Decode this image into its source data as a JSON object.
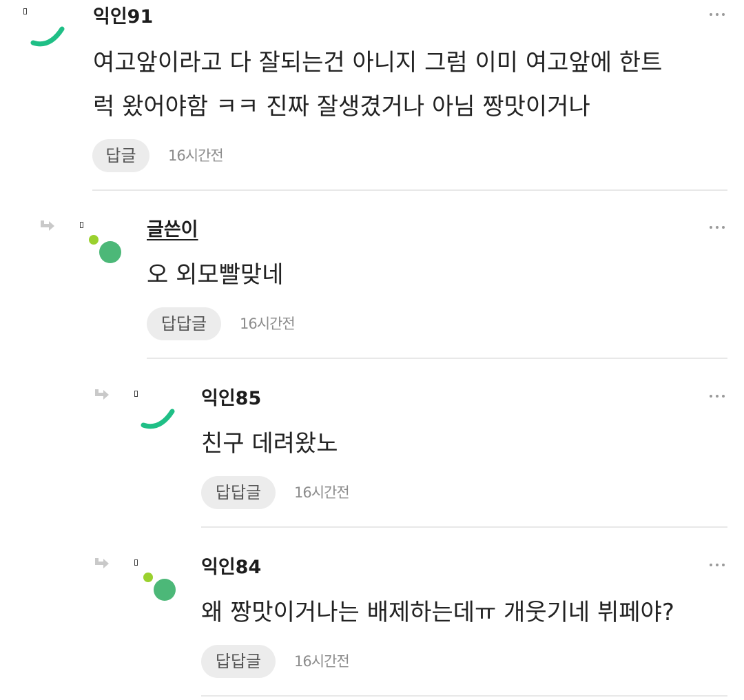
{
  "comments": [
    {
      "username": "익인91",
      "is_author": false,
      "content_line1": "여고앞이라고 다 잘되는건 아니지 그럼 이미 여고앞에 한트",
      "content_line2": "럭 왔어야함 ㅋㅋ 진짜 잘생겼거나 아님 짱맛이거나",
      "reply_label": "답글",
      "timestamp": "16시간전",
      "avatar_icon": "green-arc-avatar-icon"
    },
    {
      "username": "글쓴이",
      "is_author": true,
      "content_line1": "오 외모빨맞네",
      "reply_label": "답답글",
      "timestamp": "16시간전",
      "avatar_icon": "green-dot-avatar-icon"
    },
    {
      "username": "익인85",
      "is_author": false,
      "content_line1": "친구 데려왔노",
      "reply_label": "답답글",
      "timestamp": "16시간전",
      "avatar_icon": "green-arc-avatar-icon"
    },
    {
      "username": "익인84",
      "is_author": false,
      "content_line1": "왜 짱맛이거나는 배제하는데ㅠ 개웃기네 뷔페야?",
      "reply_label": "답답글",
      "timestamp": "16시간전",
      "avatar_icon": "green-dot-avatar-icon"
    }
  ],
  "colors": {
    "accent_green": "#1fbf86",
    "avatar_green": "#4cb878",
    "avatar_lime": "#9ad12e",
    "reply_button_bg": "#ececec",
    "divider": "#e8e8e8"
  }
}
